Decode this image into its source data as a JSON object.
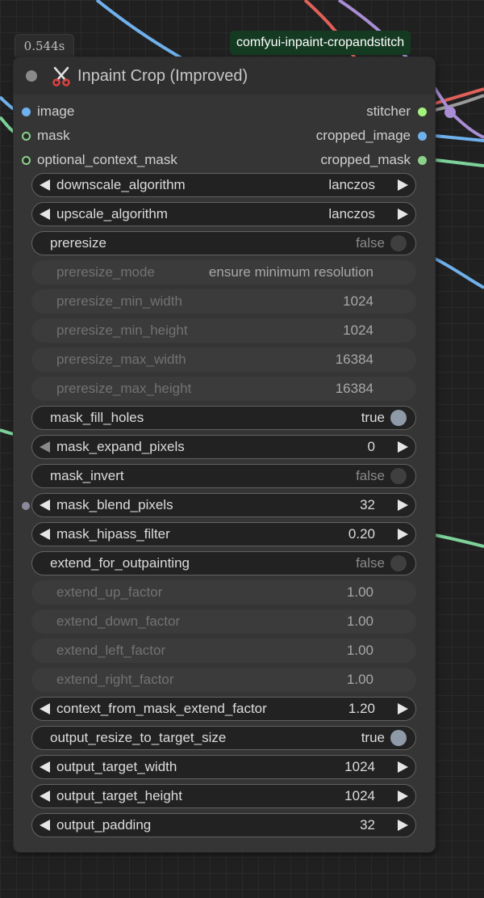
{
  "timing": "0.544s",
  "badge": "comfyui-inpaint-cropandstitch",
  "node": {
    "title": "Inpaint Crop (Improved)",
    "icon": "scissors-icon"
  },
  "inputs": [
    {
      "label": "image",
      "color": "#6fb1ec"
    },
    {
      "label": "mask",
      "color": "#8ad18a"
    },
    {
      "label": "optional_context_mask",
      "color": "#8ad18a"
    }
  ],
  "outputs": [
    {
      "label": "stitcher",
      "color": "#a4f27c"
    },
    {
      "label": "cropped_image",
      "color": "#6fb1ec"
    },
    {
      "label": "cropped_mask",
      "color": "#8ad18a"
    }
  ],
  "widgets": {
    "downscale_algorithm": {
      "label": "downscale_algorithm",
      "value": "lanczos"
    },
    "upscale_algorithm": {
      "label": "upscale_algorithm",
      "value": "lanczos"
    },
    "preresize": {
      "label": "preresize",
      "value": "false"
    },
    "preresize_mode": {
      "label": "preresize_mode",
      "value": "ensure minimum resolution"
    },
    "preresize_min_width": {
      "label": "preresize_min_width",
      "value": "1024"
    },
    "preresize_min_height": {
      "label": "preresize_min_height",
      "value": "1024"
    },
    "preresize_max_width": {
      "label": "preresize_max_width",
      "value": "16384"
    },
    "preresize_max_height": {
      "label": "preresize_max_height",
      "value": "16384"
    },
    "mask_fill_holes": {
      "label": "mask_fill_holes",
      "value": "true"
    },
    "mask_expand_pixels": {
      "label": "mask_expand_pixels",
      "value": "0"
    },
    "mask_invert": {
      "label": "mask_invert",
      "value": "false"
    },
    "mask_blend_pixels": {
      "label": "mask_blend_pixels",
      "value": "32"
    },
    "mask_hipass_filter": {
      "label": "mask_hipass_filter",
      "value": "0.20"
    },
    "extend_for_outpainting": {
      "label": "extend_for_outpainting",
      "value": "false"
    },
    "extend_up_factor": {
      "label": "extend_up_factor",
      "value": "1.00"
    },
    "extend_down_factor": {
      "label": "extend_down_factor",
      "value": "1.00"
    },
    "extend_left_factor": {
      "label": "extend_left_factor",
      "value": "1.00"
    },
    "extend_right_factor": {
      "label": "extend_right_factor",
      "value": "1.00"
    },
    "context_from_mask_extend_factor": {
      "label": "context_from_mask_extend_factor",
      "value": "1.20"
    },
    "output_resize_to_target_size": {
      "label": "output_resize_to_target_size",
      "value": "true"
    },
    "output_target_width": {
      "label": "output_target_width",
      "value": "1024"
    },
    "output_target_height": {
      "label": "output_target_height",
      "value": "1024"
    },
    "output_padding": {
      "label": "output_padding",
      "value": "32"
    }
  },
  "colors": {
    "link_blue": "#6fb1ec",
    "link_green": "#7dd29a",
    "link_red": "#e0605a",
    "link_purple": "#a98ed6",
    "link_gray": "#9a9a9a",
    "badge_bg": "#153a22"
  }
}
